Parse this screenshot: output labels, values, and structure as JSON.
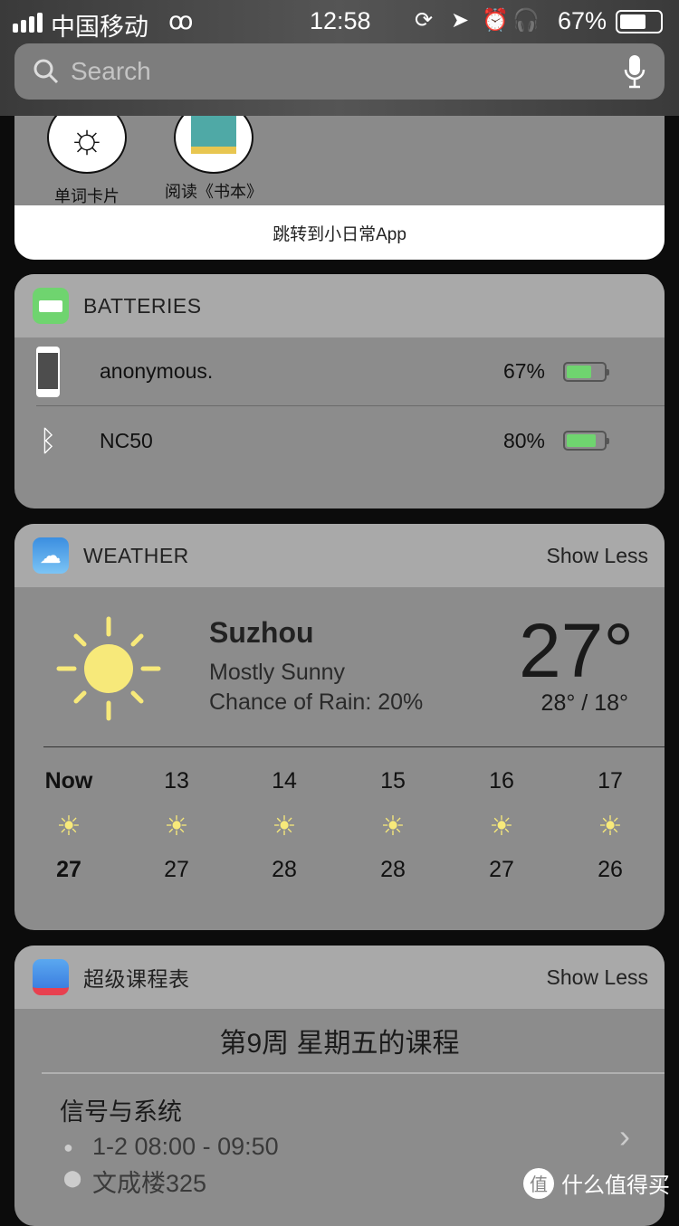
{
  "status": {
    "carrier": "中国移动",
    "time": "12:58",
    "battery": "67%",
    "battery_level": 0.67
  },
  "search": {
    "placeholder": "Search"
  },
  "xiaorichang": {
    "items": [
      {
        "label": "单词卡片"
      },
      {
        "label": "阅读《书本》"
      }
    ],
    "footer": "跳转到小日常App"
  },
  "batteries": {
    "title": "BATTERIES",
    "accent": "#6fd46f",
    "devices": [
      {
        "name": "anonymous.",
        "percent": "67%",
        "level": 0.67,
        "icon": "iphone-icon"
      },
      {
        "name": "NC50",
        "percent": "80%",
        "level": 0.8,
        "icon": "bluetooth-icon"
      }
    ]
  },
  "weather": {
    "title": "WEATHER",
    "show_less": "Show Less",
    "city": "Suzhou",
    "condition": "Mostly Sunny",
    "rain": "Chance of Rain: 20%",
    "temp": "27°",
    "hi_lo": "28° / 18°",
    "forecast": [
      {
        "label": "Now",
        "temp": "27"
      },
      {
        "label": "13",
        "temp": "27"
      },
      {
        "label": "14",
        "temp": "28"
      },
      {
        "label": "15",
        "temp": "28"
      },
      {
        "label": "16",
        "temp": "27"
      },
      {
        "label": "17",
        "temp": "26"
      }
    ]
  },
  "course": {
    "title": "超级课程表",
    "show_less": "Show Less",
    "heading": "第9周 星期五的课程",
    "name": "信号与系统",
    "time": "1-2 08:00 - 09:50",
    "location": "文成楼325"
  },
  "watermark": "什么值得买"
}
